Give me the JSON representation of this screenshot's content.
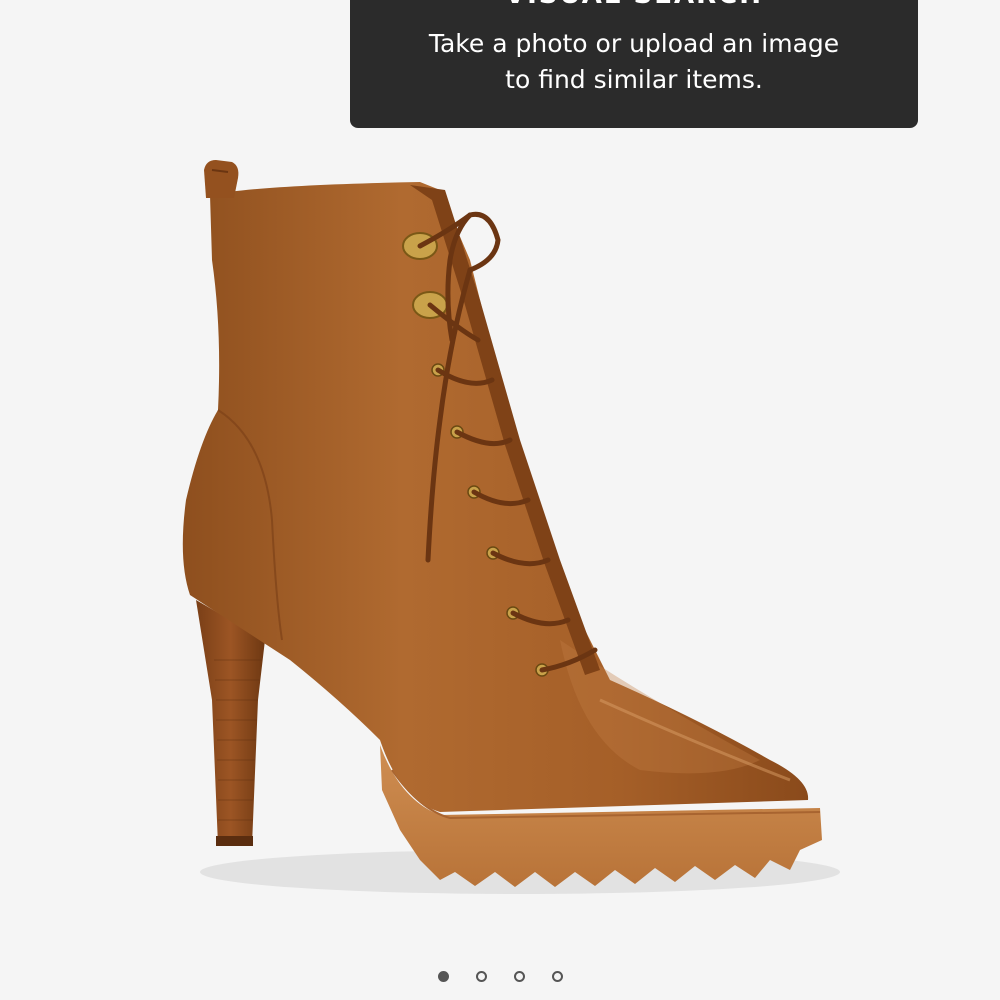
{
  "tooltip": {
    "title": "VISUAL SEARCH",
    "body_line1": "Take a photo or upload an image",
    "body_line2": "to find similar items."
  },
  "product": {
    "image_icon": "lace-up-ankle-boot-image"
  },
  "carousel": {
    "page_count": 4,
    "active_index": 0
  },
  "colors": {
    "tooltip_bg": "#2b2b2b",
    "background": "#f5f5f5",
    "leather": "#a45e28",
    "sole": "#c9874a"
  }
}
